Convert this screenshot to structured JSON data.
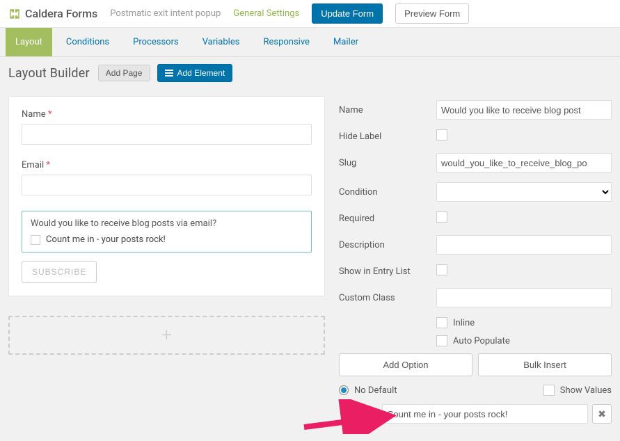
{
  "brand": {
    "name": "Caldera Forms"
  },
  "header": {
    "instance": "Postmatic exit intent popup",
    "general_settings": "General Settings",
    "update": "Update Form",
    "preview": "Preview Form"
  },
  "subtabs": [
    "Layout",
    "Conditions",
    "Processors",
    "Variables",
    "Responsive",
    "Mailer"
  ],
  "builder": {
    "title": "Layout Builder",
    "add_page": "Add Page",
    "add_element": "Add Element"
  },
  "canvas": {
    "name_label": "Name",
    "email_label": "Email",
    "checkbox_question": "Would you like to receive blog posts via email?",
    "checkbox_option": "Count me in - your posts rock!",
    "subscribe": "SUBSCRIBE",
    "dropzone_plus": "+"
  },
  "props": {
    "name_label": "Name",
    "name_value": "Would you like to receive blog post",
    "hide_label": "Hide Label",
    "slug_label": "Slug",
    "slug_value": "would_you_like_to_receive_blog_po",
    "condition_label": "Condition",
    "required_label": "Required",
    "description_label": "Description",
    "show_entry_label": "Show in Entry List",
    "custom_class_label": "Custom Class",
    "inline_label": "Inline",
    "auto_populate_label": "Auto Populate",
    "add_option": "Add Option",
    "bulk_insert": "Bulk Insert",
    "no_default": "No Default",
    "show_values": "Show Values",
    "option1_value": "Count me in - your posts rock!"
  }
}
